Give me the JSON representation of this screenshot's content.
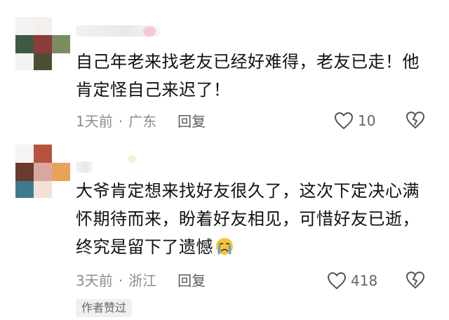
{
  "comments": [
    {
      "username": "",
      "content": "自己年老来找老友已经好难得，老友已走！他肯定怪自己来迟了！",
      "time": "1天前",
      "location": "广东",
      "reply_label": "回复",
      "likes": "10",
      "emoji": ""
    },
    {
      "username": "",
      "content": "大爷肯定想来找好友很久了，这次下定决心满怀期待而来，盼着好友相见，可惜好友已逝，终究是留下了遗憾",
      "time": "3天前",
      "location": "浙江",
      "reply_label": "回复",
      "likes": "418",
      "emoji": "crying-face-icon",
      "author_liked": "作者赞过"
    }
  ],
  "meta_separator": "·",
  "colors": {
    "text": "#111111",
    "meta": "#8c8c8c",
    "badge_bg": "#f0f0f0"
  }
}
